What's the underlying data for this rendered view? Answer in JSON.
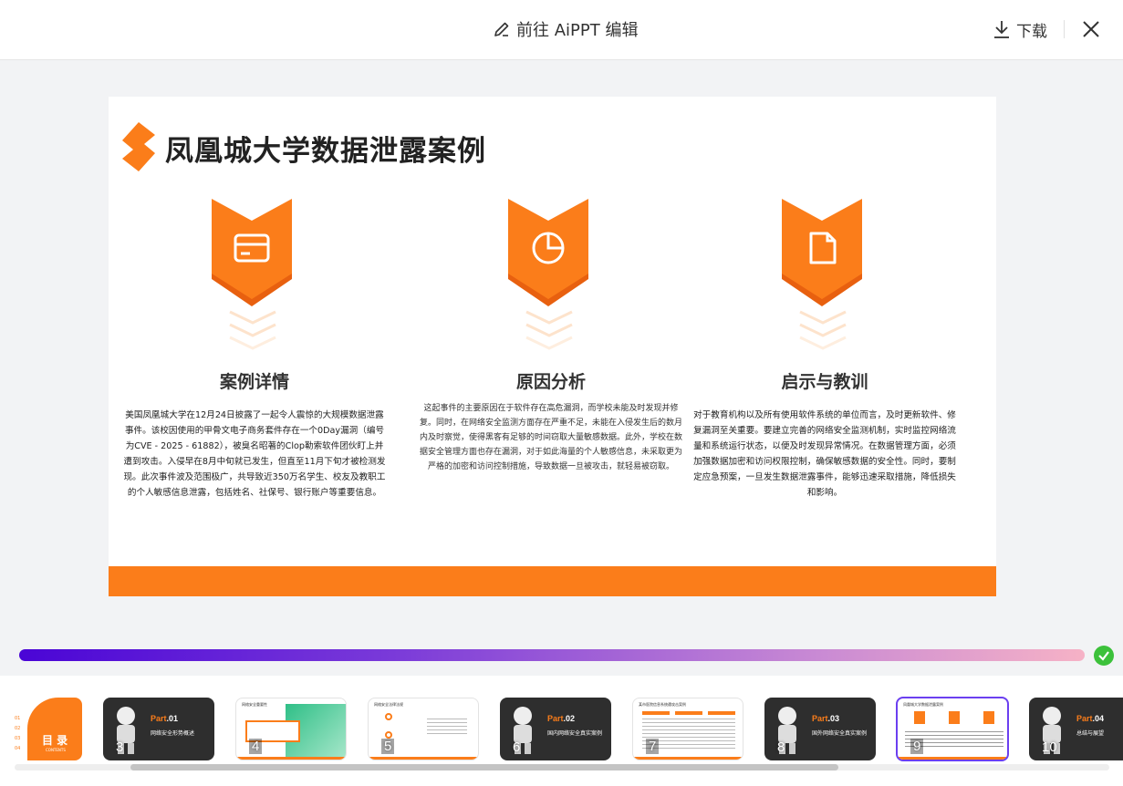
{
  "toolbar": {
    "edit_label": "前往 AiPPT 编辑",
    "download_label": "下载"
  },
  "slide": {
    "title": "凤凰城大学数据泄露案例",
    "accent": "#fb7d1a",
    "columns": [
      {
        "icon": "card-icon",
        "heading": "案例详情",
        "body": "美国凤凰城大学在12月24日披露了一起令人震惊的大规模数据泄露事件。该校因使用的甲骨文电子商务套件存在一个0Day漏洞（编号为CVE - 2025 - 61882），被臭名昭著的Clop勒索软件团伙盯上并遭到攻击。入侵早在8月中旬就已发生，但直至11月下旬才被检测发现。此次事件波及范围极广，共导致近350万名学生、校友及教职工的个人敏感信息泄露，包括姓名、社保号、银行账户等重要信息。"
      },
      {
        "icon": "pie-chart-icon",
        "heading": "原因分析",
        "body": "这起事件的主要原因在于软件存在高危漏洞，而学校未能及时发现并修复。同时，在网络安全监测方面存在严重不足，未能在入侵发生后的数月内及时察觉，使得黑客有足够的时间窃取大量敏感数据。此外，学校在数据安全管理方面也存在漏洞，对于如此海量的个人敏感信息，未采取更为严格的加密和访问控制措施，导致数据一旦被攻击，就轻易被窃取。"
      },
      {
        "icon": "document-icon",
        "heading": "启示与教训",
        "body": "对于教育机构以及所有使用软件系统的单位而言，及时更新软件、修复漏洞至关重要。要建立完善的网络安全监测机制，实时监控网络流量和系统运行状态，以便及时发现异常情况。在数据管理方面，必须加强数据加密和访问权限控制，确保敏感数据的安全性。同时，要制定应急预案，一旦发生数据泄露事件，能够迅速采取措施，降低损失和影响。"
      }
    ]
  },
  "progress": {
    "fraction": 1.0,
    "status_icon": "check-circle-icon"
  },
  "thumbnails": [
    {
      "num": "",
      "kind": "toc",
      "title": "目 录",
      "sub": "CONTENTS",
      "items": [
        "01",
        "02",
        "03",
        "04"
      ]
    },
    {
      "num": "3",
      "kind": "part",
      "part": "Part.01",
      "sub": "网络安全形势概述"
    },
    {
      "num": "4",
      "kind": "light",
      "title": "网络安全重要性"
    },
    {
      "num": "5",
      "kind": "light",
      "title": "网络安全法律法规"
    },
    {
      "num": "6",
      "kind": "part",
      "part": "Part.02",
      "sub": "国内网络安全真实案例"
    },
    {
      "num": "7",
      "kind": "light",
      "title": "某市医院信息系统遭攻击案例"
    },
    {
      "num": "8",
      "kind": "part",
      "part": "Part.03",
      "sub": "国外网络安全真实案例"
    },
    {
      "num": "9",
      "kind": "active",
      "title": "凤凰城大学数据泄露案例"
    },
    {
      "num": "10",
      "kind": "part",
      "part": "Part.04",
      "sub": "总结与展望"
    }
  ]
}
